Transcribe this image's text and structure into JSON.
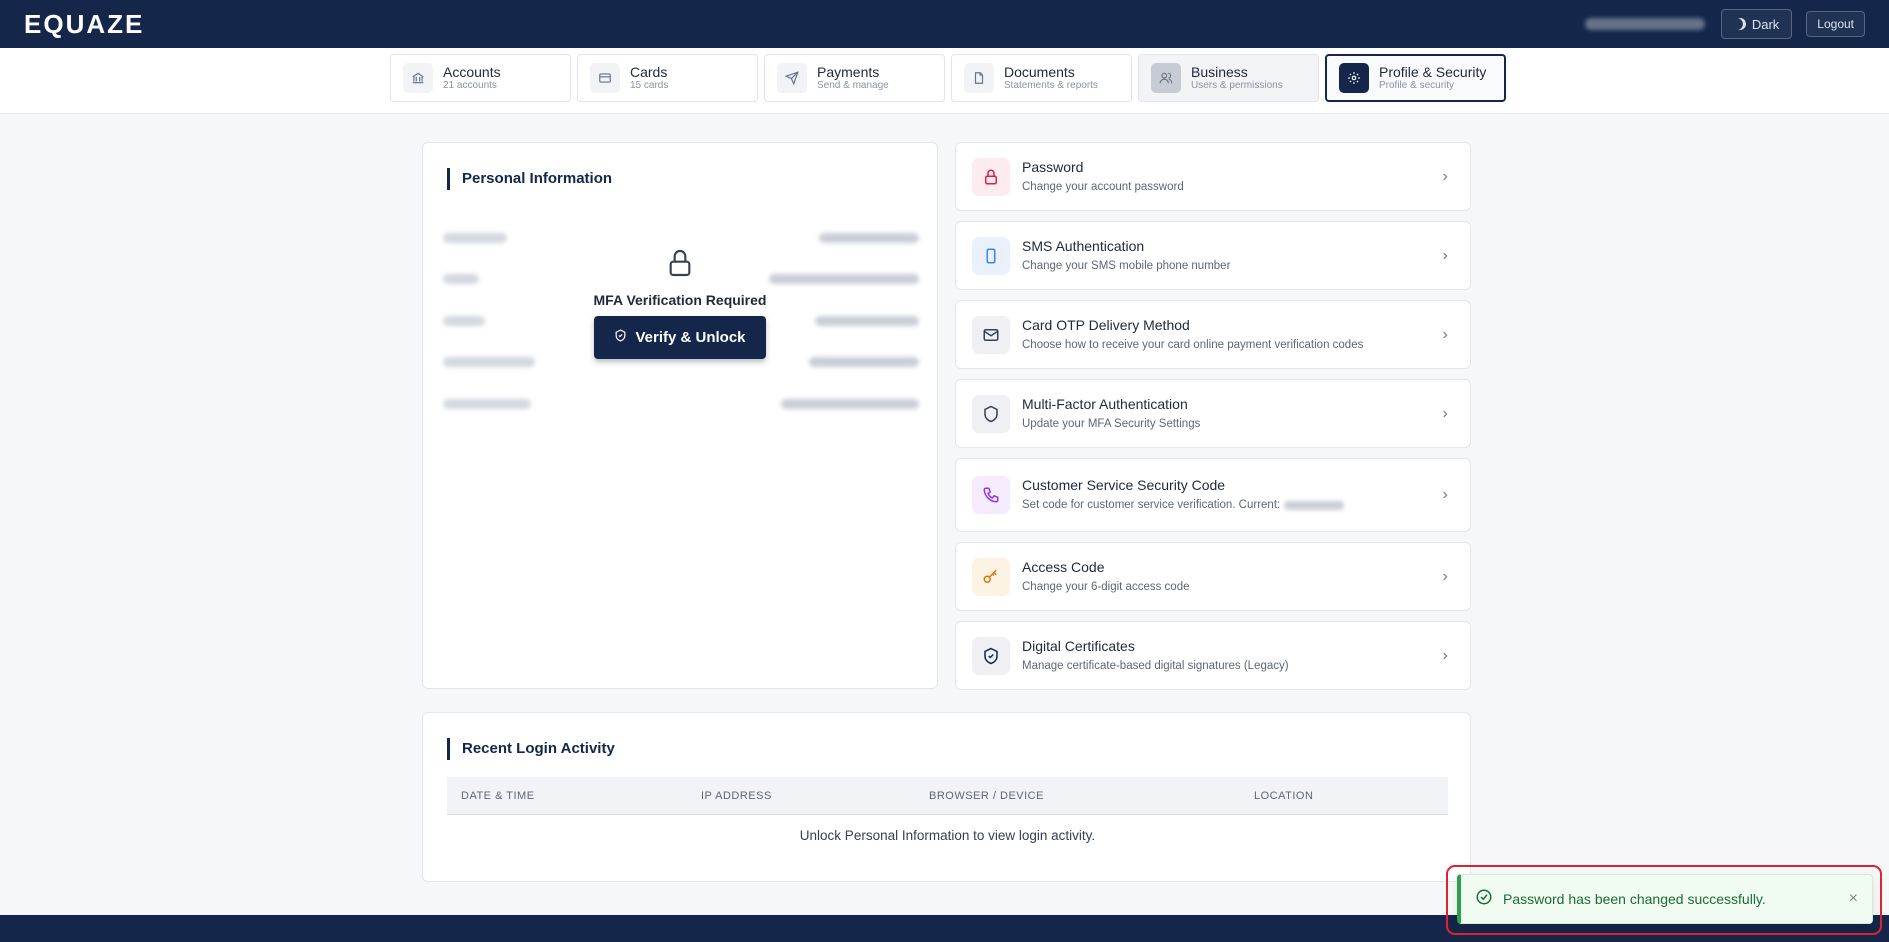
{
  "header": {
    "logo": "EQUAZE",
    "dark_label": "Dark",
    "logout_label": "Logout"
  },
  "nav": {
    "tabs": [
      {
        "title": "Accounts",
        "sub": "21 accounts",
        "icon": "bank-icon"
      },
      {
        "title": "Cards",
        "sub": "15 cards",
        "icon": "credit-card-icon"
      },
      {
        "title": "Payments",
        "sub": "Send & manage",
        "icon": "send-icon"
      },
      {
        "title": "Documents",
        "sub": "Statements & reports",
        "icon": "document-icon"
      },
      {
        "title": "Business",
        "sub": "Users & permissions",
        "icon": "users-icon"
      },
      {
        "title": "Profile & Security",
        "sub": "Profile & security",
        "icon": "gear-icon"
      }
    ],
    "active_tab": "Profile & Security"
  },
  "personal_info": {
    "title": "Personal Information",
    "mfa_title": "MFA Verification Required",
    "verify_label": "Verify & Unlock"
  },
  "security_options": [
    {
      "title": "Password",
      "sub": "Change your account password",
      "icon": "lock-icon",
      "color": "#e11d48"
    },
    {
      "title": "SMS Authentication",
      "sub": "Change your SMS mobile phone number",
      "icon": "phone-icon",
      "color": "#3b82f6"
    },
    {
      "title": "Card OTP Delivery Method",
      "sub": "Choose how to receive your card online payment verification codes",
      "icon": "mail-icon",
      "color": "#334155"
    },
    {
      "title": "Multi-Factor Authentication",
      "sub": "Update your MFA Security Settings",
      "icon": "shield-icon",
      "color": "#334155"
    },
    {
      "title": "Customer Service Security Code",
      "sub": "Set code for customer service verification. Current:",
      "icon": "phone-call-icon",
      "color": "#9333ea"
    },
    {
      "title": "Access Code",
      "sub": "Change your 6-digit access code",
      "icon": "key-icon",
      "color": "#d97706"
    },
    {
      "title": "Digital Certificates",
      "sub": "Manage certificate-based digital signatures (Legacy)",
      "icon": "shield-check-icon",
      "color": "#14274a"
    }
  ],
  "login_activity": {
    "title": "Recent Login Activity",
    "columns": [
      "DATE & TIME",
      "IP ADDRESS",
      "BROWSER / DEVICE",
      "LOCATION"
    ],
    "empty_message": "Unlock Personal Information to view login activity."
  },
  "toast": {
    "message": "Password has been changed successfully.",
    "close": "×"
  }
}
